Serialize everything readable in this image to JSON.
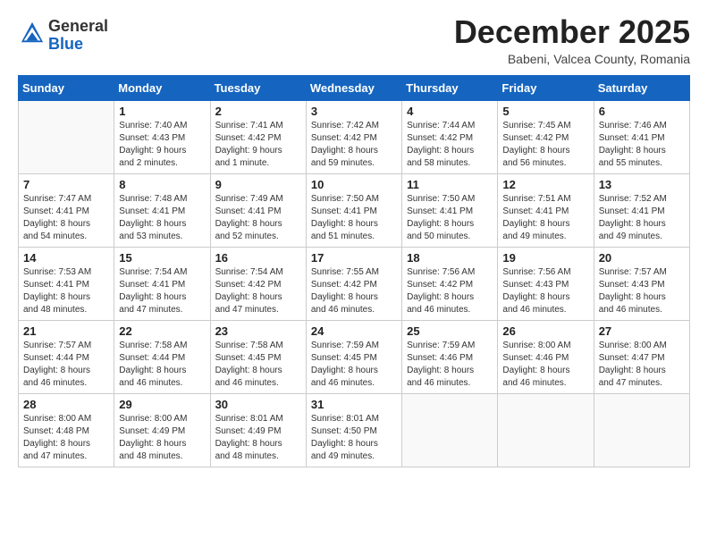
{
  "header": {
    "logo_general": "General",
    "logo_blue": "Blue",
    "month_title": "December 2025",
    "subtitle": "Babeni, Valcea County, Romania"
  },
  "days_of_week": [
    "Sunday",
    "Monday",
    "Tuesday",
    "Wednesday",
    "Thursday",
    "Friday",
    "Saturday"
  ],
  "weeks": [
    [
      {
        "day": "",
        "info": ""
      },
      {
        "day": "1",
        "info": "Sunrise: 7:40 AM\nSunset: 4:43 PM\nDaylight: 9 hours\nand 2 minutes."
      },
      {
        "day": "2",
        "info": "Sunrise: 7:41 AM\nSunset: 4:42 PM\nDaylight: 9 hours\nand 1 minute."
      },
      {
        "day": "3",
        "info": "Sunrise: 7:42 AM\nSunset: 4:42 PM\nDaylight: 8 hours\nand 59 minutes."
      },
      {
        "day": "4",
        "info": "Sunrise: 7:44 AM\nSunset: 4:42 PM\nDaylight: 8 hours\nand 58 minutes."
      },
      {
        "day": "5",
        "info": "Sunrise: 7:45 AM\nSunset: 4:42 PM\nDaylight: 8 hours\nand 56 minutes."
      },
      {
        "day": "6",
        "info": "Sunrise: 7:46 AM\nSunset: 4:41 PM\nDaylight: 8 hours\nand 55 minutes."
      }
    ],
    [
      {
        "day": "7",
        "info": "Sunrise: 7:47 AM\nSunset: 4:41 PM\nDaylight: 8 hours\nand 54 minutes."
      },
      {
        "day": "8",
        "info": "Sunrise: 7:48 AM\nSunset: 4:41 PM\nDaylight: 8 hours\nand 53 minutes."
      },
      {
        "day": "9",
        "info": "Sunrise: 7:49 AM\nSunset: 4:41 PM\nDaylight: 8 hours\nand 52 minutes."
      },
      {
        "day": "10",
        "info": "Sunrise: 7:50 AM\nSunset: 4:41 PM\nDaylight: 8 hours\nand 51 minutes."
      },
      {
        "day": "11",
        "info": "Sunrise: 7:50 AM\nSunset: 4:41 PM\nDaylight: 8 hours\nand 50 minutes."
      },
      {
        "day": "12",
        "info": "Sunrise: 7:51 AM\nSunset: 4:41 PM\nDaylight: 8 hours\nand 49 minutes."
      },
      {
        "day": "13",
        "info": "Sunrise: 7:52 AM\nSunset: 4:41 PM\nDaylight: 8 hours\nand 49 minutes."
      }
    ],
    [
      {
        "day": "14",
        "info": "Sunrise: 7:53 AM\nSunset: 4:41 PM\nDaylight: 8 hours\nand 48 minutes."
      },
      {
        "day": "15",
        "info": "Sunrise: 7:54 AM\nSunset: 4:41 PM\nDaylight: 8 hours\nand 47 minutes."
      },
      {
        "day": "16",
        "info": "Sunrise: 7:54 AM\nSunset: 4:42 PM\nDaylight: 8 hours\nand 47 minutes."
      },
      {
        "day": "17",
        "info": "Sunrise: 7:55 AM\nSunset: 4:42 PM\nDaylight: 8 hours\nand 46 minutes."
      },
      {
        "day": "18",
        "info": "Sunrise: 7:56 AM\nSunset: 4:42 PM\nDaylight: 8 hours\nand 46 minutes."
      },
      {
        "day": "19",
        "info": "Sunrise: 7:56 AM\nSunset: 4:43 PM\nDaylight: 8 hours\nand 46 minutes."
      },
      {
        "day": "20",
        "info": "Sunrise: 7:57 AM\nSunset: 4:43 PM\nDaylight: 8 hours\nand 46 minutes."
      }
    ],
    [
      {
        "day": "21",
        "info": "Sunrise: 7:57 AM\nSunset: 4:44 PM\nDaylight: 8 hours\nand 46 minutes."
      },
      {
        "day": "22",
        "info": "Sunrise: 7:58 AM\nSunset: 4:44 PM\nDaylight: 8 hours\nand 46 minutes."
      },
      {
        "day": "23",
        "info": "Sunrise: 7:58 AM\nSunset: 4:45 PM\nDaylight: 8 hours\nand 46 minutes."
      },
      {
        "day": "24",
        "info": "Sunrise: 7:59 AM\nSunset: 4:45 PM\nDaylight: 8 hours\nand 46 minutes."
      },
      {
        "day": "25",
        "info": "Sunrise: 7:59 AM\nSunset: 4:46 PM\nDaylight: 8 hours\nand 46 minutes."
      },
      {
        "day": "26",
        "info": "Sunrise: 8:00 AM\nSunset: 4:46 PM\nDaylight: 8 hours\nand 46 minutes."
      },
      {
        "day": "27",
        "info": "Sunrise: 8:00 AM\nSunset: 4:47 PM\nDaylight: 8 hours\nand 47 minutes."
      }
    ],
    [
      {
        "day": "28",
        "info": "Sunrise: 8:00 AM\nSunset: 4:48 PM\nDaylight: 8 hours\nand 47 minutes."
      },
      {
        "day": "29",
        "info": "Sunrise: 8:00 AM\nSunset: 4:49 PM\nDaylight: 8 hours\nand 48 minutes."
      },
      {
        "day": "30",
        "info": "Sunrise: 8:01 AM\nSunset: 4:49 PM\nDaylight: 8 hours\nand 48 minutes."
      },
      {
        "day": "31",
        "info": "Sunrise: 8:01 AM\nSunset: 4:50 PM\nDaylight: 8 hours\nand 49 minutes."
      },
      {
        "day": "",
        "info": ""
      },
      {
        "day": "",
        "info": ""
      },
      {
        "day": "",
        "info": ""
      }
    ]
  ]
}
